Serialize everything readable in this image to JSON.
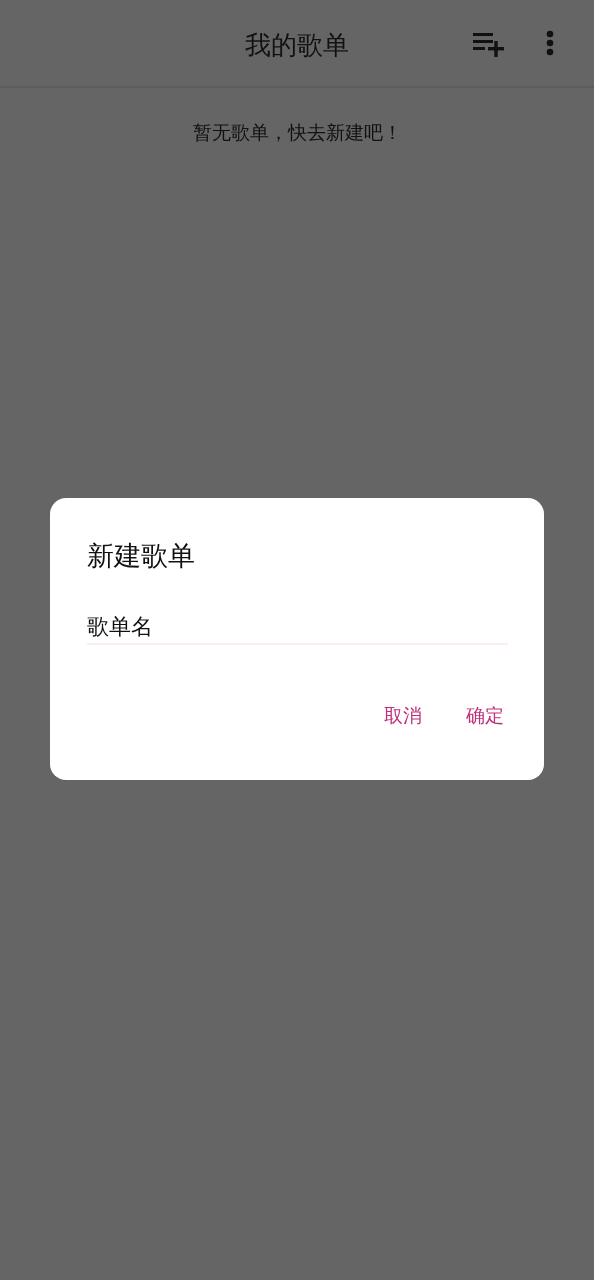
{
  "app_bar": {
    "title": "我的歌单"
  },
  "empty_message": "暂无歌单，快去新建吧！",
  "dialog": {
    "title": "新建歌单",
    "field": {
      "value": "歌单名"
    },
    "buttons": [
      {
        "label": "取消"
      },
      {
        "label": "确定"
      }
    ]
  }
}
